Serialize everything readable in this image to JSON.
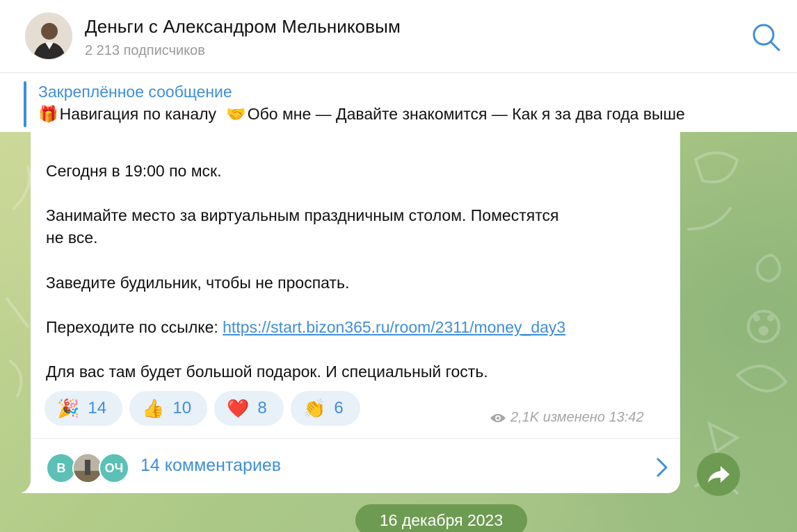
{
  "header": {
    "title": "Деньги с Александром Мельниковым",
    "subscribers": "2 213 подписчиков"
  },
  "pinned": {
    "title": "Закреплённое сообщение",
    "text_part1": "Навигация по каналу",
    "text_part2": "Обо мне — Давайте знакомится — Как я за два года выше",
    "emoji1": "🎁",
    "emoji2": "🤝"
  },
  "message": {
    "line1": "Сегодня в 19:00 по мск.",
    "line2": "Занимайте место за виртуальным праздничным столом. Поместятся",
    "line2b": "не все.",
    "line3": "Заведите будильник, чтобы не проспать.",
    "line4_prefix": "Переходите по ссылке:",
    "link": "https://start.bizon365.ru/room/2311/money_day3",
    "line5": "Для вас там будет большой подарок. И специальный гость."
  },
  "reactions": [
    {
      "emoji": "🎉",
      "count": "14"
    },
    {
      "emoji": "👍",
      "count": "10"
    },
    {
      "emoji": "❤️",
      "count": "8"
    },
    {
      "emoji": "👏",
      "count": "6"
    }
  ],
  "meta": {
    "views": "2,1K",
    "edited_time": "изменено 13:42"
  },
  "comments": {
    "label": "14 комментариев",
    "avatar1": "В",
    "avatar3": "ОЧ"
  },
  "date_separator": "16 декабря 2023",
  "colors": {
    "accent": "#3f8ed8",
    "reaction_bg": "#e8f0f8",
    "pill_green": "#6e9b52"
  }
}
